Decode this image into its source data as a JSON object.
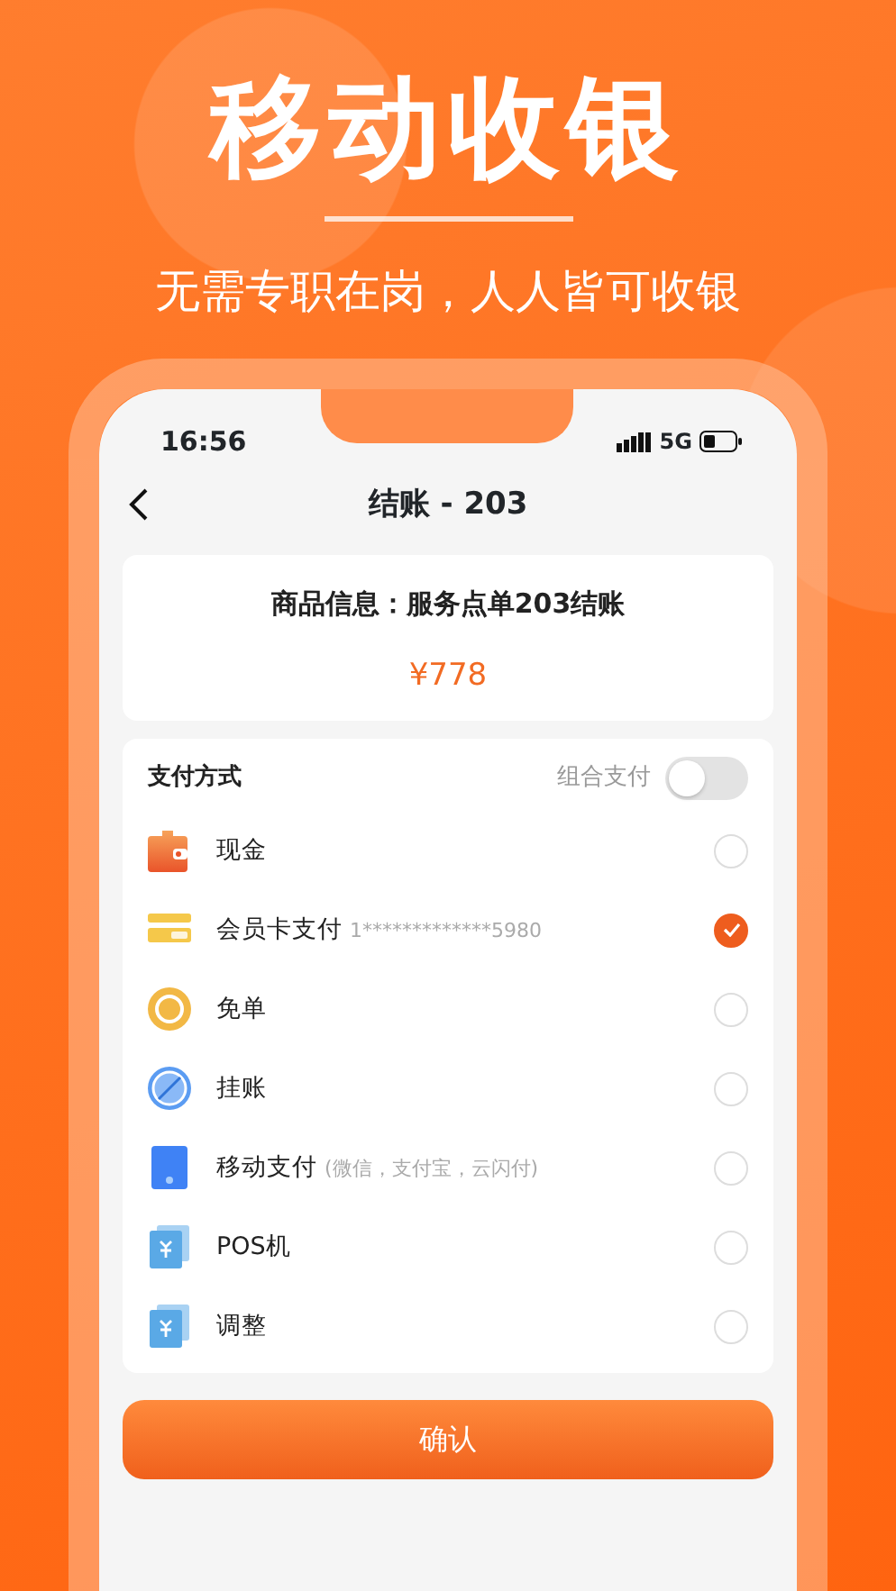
{
  "hero": {
    "title": "移动收银",
    "subtitle": "无需专职在岗，人人皆可收银"
  },
  "status_bar": {
    "time": "16:56",
    "network": "5G"
  },
  "header": {
    "title": "结账 - 203"
  },
  "order": {
    "info": "商品信息：服务点单203结账",
    "amount": "¥778"
  },
  "payment": {
    "title": "支付方式",
    "combined_label": "组合支付",
    "combined_on": false,
    "methods": [
      {
        "kind": "cash",
        "label": "现金",
        "selected": false
      },
      {
        "kind": "vip_card",
        "label": "会员卡支付",
        "note": "1*************5980",
        "selected": true
      },
      {
        "kind": "free",
        "label": "免单",
        "selected": false
      },
      {
        "kind": "credit",
        "label": "挂账",
        "selected": false
      },
      {
        "kind": "mobile",
        "label": "移动支付",
        "note": "(微信，支付宝，云闪付)",
        "selected": false
      },
      {
        "kind": "pos",
        "label": "POS机",
        "selected": false
      },
      {
        "kind": "adjust",
        "label": "调整",
        "selected": false
      }
    ]
  },
  "confirm_button": "确认"
}
